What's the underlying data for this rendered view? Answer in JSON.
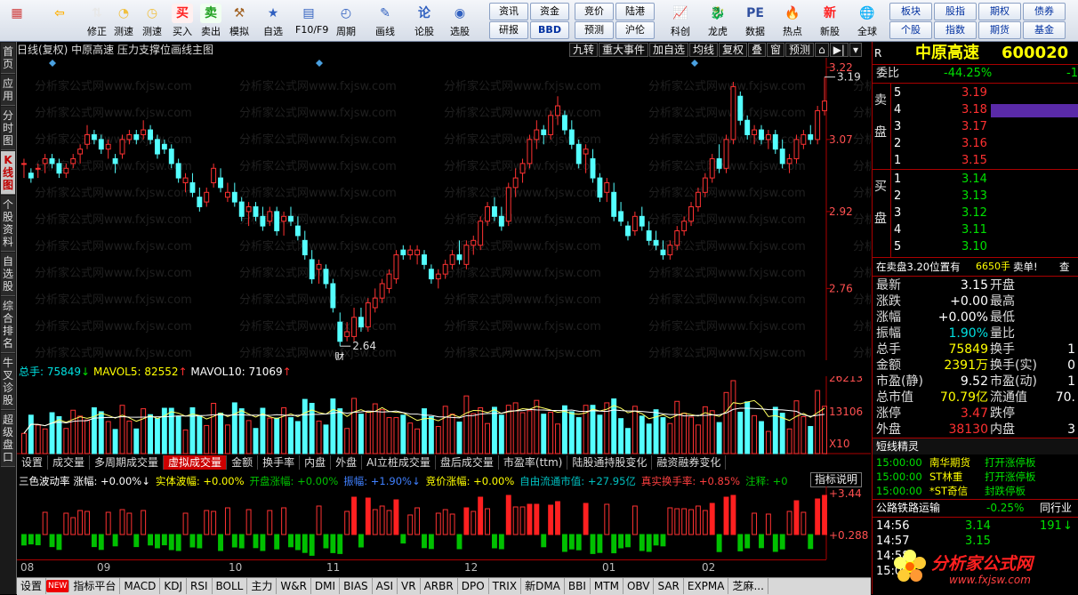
{
  "toolbar": {
    "buttons": [
      {
        "label": "",
        "icon": "windows-icon"
      },
      {
        "label": "",
        "icon": "back-arrow-icon"
      },
      {
        "label": "修正",
        "icon": "up-down-arrow-icon"
      },
      {
        "label": "测速",
        "icon": "speed-test-icon"
      },
      {
        "label": "测速",
        "icon": "clock-icon"
      },
      {
        "label": "买入",
        "icon": "buy-icon"
      },
      {
        "label": "卖出",
        "icon": "sell-icon"
      },
      {
        "label": "模拟",
        "icon": "gavel-icon"
      },
      {
        "label": "自选",
        "icon": "favorites-icon"
      },
      {
        "label": "F10/F9",
        "icon": "f10-icon"
      },
      {
        "label": "周期",
        "icon": "period-icon"
      },
      {
        "label": "画线",
        "icon": "draw-line-icon"
      },
      {
        "label": "论股",
        "icon": "discuss-icon"
      },
      {
        "label": "选股",
        "icon": "stock-picker-icon"
      }
    ],
    "small_grid_1": [
      "资讯",
      "资金",
      "竞价",
      "陆港",
      "研报",
      "BBD",
      "预测",
      "沪伦"
    ],
    "big_buttons": [
      {
        "label": "科创",
        "icon": "chart-icon"
      },
      {
        "label": "龙虎",
        "icon": "dragon-tiger-icon"
      },
      {
        "label": "数据",
        "icon": "pe-data-icon"
      },
      {
        "label": "热点",
        "icon": "hotspot-icon"
      },
      {
        "label": "新股",
        "icon": "new-stock-icon"
      },
      {
        "label": "全球",
        "icon": "globe-icon"
      }
    ],
    "small_grid_2": [
      "板块",
      "股指",
      "期权",
      "债券",
      "个股",
      "指数",
      "期货",
      "基金"
    ]
  },
  "left_tabs": [
    {
      "label": "首页",
      "active": false
    },
    {
      "label": "应用",
      "active": false
    },
    {
      "label": "分时图",
      "active": false
    },
    {
      "label": "K线图",
      "active": true
    },
    {
      "label": "个股资料",
      "active": false
    },
    {
      "label": "自选股",
      "active": false
    },
    {
      "label": "综合排名",
      "active": false
    },
    {
      "label": "牛叉诊股",
      "active": false
    },
    {
      "label": "超级盘口",
      "active": false
    }
  ],
  "main_chart": {
    "header": "日线(复权)  中原高速  压力支撑位画线主图",
    "tools": [
      "九转",
      "重大事件",
      "加自选",
      "均线",
      "复权",
      "叠",
      "窗",
      "预测",
      "⌂",
      "▶|",
      "▾"
    ],
    "price_axis": [
      "3.22",
      "3.07",
      "2.92",
      "2.76"
    ],
    "high_label": "3.19",
    "low_label": "2.64",
    "event_marker": "财",
    "watermark": "分析家公式网www.fxjsw.com"
  },
  "volume": {
    "header_total_label": "总手: 75849",
    "header_ma5_label": "MAVOL5: 82552",
    "header_ma10_label": "MAVOL10: 71069",
    "axis": [
      "26213",
      "13106",
      "X10"
    ]
  },
  "volume_tabs": [
    {
      "label": "设置",
      "active": false
    },
    {
      "label": "成交量",
      "active": false
    },
    {
      "label": "多周期成交量",
      "active": false
    },
    {
      "label": "虚拟成交量",
      "active": true
    },
    {
      "label": "金额",
      "active": false
    },
    {
      "label": "换手率",
      "active": false
    },
    {
      "label": "内盘",
      "active": false
    },
    {
      "label": "外盘",
      "active": false
    },
    {
      "label": "AI立桩成交量",
      "active": false
    },
    {
      "label": "盘后成交量",
      "active": false
    },
    {
      "label": "市盈率(ttm)",
      "active": false
    },
    {
      "label": "陆股通持股变化",
      "active": false
    },
    {
      "label": "融资融券变化",
      "active": false
    }
  ],
  "indicator": {
    "name": "三色波动率",
    "items": [
      {
        "label": "涨幅: +0.00%↓",
        "color": "#ffffff"
      },
      {
        "label": "实体波幅: +0.00%",
        "color": "#ffff00"
      },
      {
        "label": "开盘涨幅: +0.00%",
        "color": "#00c000"
      },
      {
        "label": "振幅: +1.90%↓",
        "color": "#4080ff"
      },
      {
        "label": "竞价涨幅: +0.00%",
        "color": "#ffff00"
      },
      {
        "label": "自由流通市值: +27.95亿",
        "color": "#00c0c0"
      },
      {
        "label": "真实换手率: +0.85%",
        "color": "#ff4040"
      },
      {
        "label": "注释: +0",
        "color": "#00c000"
      }
    ],
    "button": "指标说明",
    "axis": [
      "+3.44",
      "+0.288"
    ]
  },
  "x_axis": [
    "08",
    "09",
    "10",
    "11",
    "12",
    "01",
    "02"
  ],
  "bottom_tabs": [
    "设置",
    "NEW",
    "指标平台",
    "MACD",
    "KDJ",
    "RSI",
    "BOLL",
    "主力",
    "W&R",
    "DMI",
    "BIAS",
    "ASI",
    "VR",
    "ARBR",
    "DPO",
    "TRIX",
    "新DMA",
    "BBI",
    "MTM",
    "OBV",
    "SAR",
    "EXPMA",
    "芝麻..."
  ],
  "quote": {
    "market": "R",
    "name": "中原高速",
    "code": "600020",
    "weibi_label": "委比",
    "weibi": "-44.25%",
    "weibi_extra": "-1",
    "sell_side": "卖盘",
    "buy_side": "买盘",
    "asks": [
      {
        "level": "5",
        "price": "3.19",
        "vol": ""
      },
      {
        "level": "4",
        "price": "3.18",
        "vol": ""
      },
      {
        "level": "3",
        "price": "3.17",
        "vol": ""
      },
      {
        "level": "2",
        "price": "3.16",
        "vol": ""
      },
      {
        "level": "1",
        "price": "3.15",
        "vol": ""
      }
    ],
    "bids": [
      {
        "level": "1",
        "price": "3.14",
        "vol": ""
      },
      {
        "level": "2",
        "price": "3.13",
        "vol": ""
      },
      {
        "level": "3",
        "price": "3.12",
        "vol": ""
      },
      {
        "level": "4",
        "price": "3.11",
        "vol": ""
      },
      {
        "level": "5",
        "price": "3.10",
        "vol": ""
      }
    ],
    "alert_text": "在卖盘3.20位置有",
    "alert_vol": "6650手",
    "alert_tail": "卖单!",
    "alert_link": "查",
    "stats_left": [
      {
        "label": "最新",
        "value": "3.15",
        "cls": "white"
      },
      {
        "label": "涨跌",
        "value": "+0.00",
        "cls": "white"
      },
      {
        "label": "涨幅",
        "value": "+0.00%",
        "cls": "white"
      },
      {
        "label": "振幅",
        "value": "1.90%",
        "cls": "cyan"
      },
      {
        "label": "总手",
        "value": "75849",
        "cls": "yellow"
      },
      {
        "label": "金额",
        "value": "2391万",
        "cls": "yellow"
      },
      {
        "label": "市盈(静)",
        "value": "9.52",
        "cls": "white"
      },
      {
        "label": "总市值",
        "value": "70.79亿",
        "cls": "yellow"
      },
      {
        "label": "涨停",
        "value": "3.47",
        "cls": "red"
      },
      {
        "label": "外盘",
        "value": "38130",
        "cls": "red"
      }
    ],
    "stats_right": [
      {
        "label": "开盘",
        "value": ""
      },
      {
        "label": "最高",
        "value": ""
      },
      {
        "label": "最低",
        "value": ""
      },
      {
        "label": "量比",
        "value": ""
      },
      {
        "label": "换手",
        "value": "1"
      },
      {
        "label": "换手(实)",
        "value": "0"
      },
      {
        "label": "市盈(动)",
        "value": "1"
      },
      {
        "label": "流通值",
        "value": "70."
      },
      {
        "label": "跌停",
        "value": ""
      },
      {
        "label": "内盘",
        "value": "3"
      }
    ],
    "spirit_title": "短线精灵",
    "spirit": [
      {
        "time": "15:00:00",
        "name": "南华期货",
        "event": "打开涨停板"
      },
      {
        "time": "15:00:00",
        "name": "ST林重",
        "event": "打开涨停板"
      },
      {
        "time": "15:00:00",
        "name": "*ST奇信",
        "event": "封跌停板"
      }
    ],
    "sector_name": "公路铁路运输",
    "sector_change": "-0.25%",
    "sector_link": "同行业",
    "ticks": [
      {
        "time": "14:56",
        "price": "3.14",
        "vol": "191",
        "dir": "↓"
      },
      {
        "time": "14:57",
        "price": "3.15",
        "vol": "",
        "dir": ""
      },
      {
        "time": "14:58",
        "price": "",
        "vol": "",
        "dir": ""
      },
      {
        "time": "15:00",
        "price": "",
        "vol": "",
        "dir": ""
      }
    ],
    "logo_text": "分析家公式网",
    "logo_url": "www.fxjsw.com"
  },
  "chart_data": {
    "type": "candlestick",
    "title": "",
    "price_range": [
      2.62,
      3.24
    ],
    "candles": [
      [
        3.02,
        3.03,
        2.99,
        3.02
      ],
      [
        3.0,
        3.01,
        2.98,
        2.99
      ],
      [
        3.01,
        3.02,
        2.99,
        3.01
      ],
      [
        3.02,
        3.04,
        3.0,
        3.03
      ],
      [
        3.03,
        3.04,
        3.01,
        3.02
      ],
      [
        3.02,
        3.03,
        2.99,
        3.0
      ],
      [
        3.0,
        3.02,
        2.99,
        3.01
      ],
      [
        3.02,
        3.04,
        3.01,
        3.03
      ],
      [
        3.04,
        3.06,
        3.02,
        3.05
      ],
      [
        3.06,
        3.1,
        3.05,
        3.08
      ],
      [
        3.08,
        3.09,
        3.06,
        3.07
      ],
      [
        3.07,
        3.08,
        3.04,
        3.05
      ],
      [
        3.05,
        3.07,
        3.03,
        3.06
      ],
      [
        3.03,
        3.04,
        3.0,
        3.02
      ],
      [
        3.04,
        3.08,
        3.03,
        3.07
      ],
      [
        3.07,
        3.09,
        3.06,
        3.08
      ],
      [
        3.08,
        3.09,
        3.06,
        3.07
      ],
      [
        3.08,
        3.11,
        3.07,
        3.09
      ],
      [
        3.09,
        3.1,
        3.06,
        3.07
      ],
      [
        3.07,
        3.08,
        3.03,
        3.04
      ],
      [
        3.06,
        3.07,
        3.04,
        3.05
      ],
      [
        3.05,
        3.06,
        3.01,
        3.02
      ],
      [
        3.02,
        3.03,
        2.98,
        2.99
      ],
      [
        2.98,
        3.0,
        2.96,
        2.99
      ],
      [
        2.98,
        3.0,
        2.95,
        2.96
      ],
      [
        2.95,
        2.97,
        2.92,
        2.93
      ],
      [
        2.94,
        2.97,
        2.93,
        2.96
      ],
      [
        2.98,
        3.02,
        2.97,
        3.01
      ],
      [
        2.99,
        3.01,
        2.96,
        2.97
      ],
      [
        2.95,
        2.98,
        2.94,
        2.96
      ],
      [
        2.96,
        2.98,
        2.93,
        2.94
      ],
      [
        2.94,
        2.95,
        2.9,
        2.91
      ],
      [
        2.92,
        2.94,
        2.89,
        2.93
      ],
      [
        2.93,
        2.94,
        2.9,
        2.91
      ],
      [
        2.91,
        2.93,
        2.88,
        2.89
      ],
      [
        2.9,
        2.93,
        2.89,
        2.92
      ],
      [
        2.92,
        2.93,
        2.87,
        2.88
      ],
      [
        2.9,
        2.92,
        2.87,
        2.91
      ],
      [
        2.91,
        2.93,
        2.89,
        2.9
      ],
      [
        2.89,
        2.91,
        2.86,
        2.87
      ],
      [
        2.86,
        2.88,
        2.82,
        2.83
      ],
      [
        2.82,
        2.84,
        2.77,
        2.78
      ],
      [
        2.8,
        2.82,
        2.77,
        2.81
      ],
      [
        2.8,
        2.81,
        2.76,
        2.77
      ],
      [
        2.77,
        2.78,
        2.71,
        2.72
      ],
      [
        2.69,
        2.71,
        2.64,
        2.65
      ],
      [
        2.66,
        2.69,
        2.65,
        2.67
      ],
      [
        2.66,
        2.72,
        2.65,
        2.7
      ],
      [
        2.7,
        2.72,
        2.67,
        2.68
      ],
      [
        2.68,
        2.74,
        2.67,
        2.73
      ],
      [
        2.72,
        2.76,
        2.71,
        2.74
      ],
      [
        2.74,
        2.78,
        2.73,
        2.77
      ],
      [
        2.76,
        2.8,
        2.75,
        2.79
      ],
      [
        2.78,
        2.84,
        2.77,
        2.83
      ],
      [
        2.84,
        2.85,
        2.82,
        2.83
      ],
      [
        2.83,
        2.85,
        2.82,
        2.84
      ],
      [
        2.83,
        2.85,
        2.81,
        2.84
      ],
      [
        2.83,
        2.84,
        2.8,
        2.81
      ],
      [
        2.8,
        2.81,
        2.77,
        2.78
      ],
      [
        2.78,
        2.8,
        2.76,
        2.79
      ],
      [
        2.79,
        2.82,
        2.78,
        2.81
      ],
      [
        2.81,
        2.84,
        2.8,
        2.83
      ],
      [
        2.83,
        2.86,
        2.81,
        2.82
      ],
      [
        2.81,
        2.86,
        2.8,
        2.85
      ],
      [
        2.85,
        2.87,
        2.83,
        2.86
      ],
      [
        2.85,
        2.91,
        2.84,
        2.9
      ],
      [
        2.9,
        2.94,
        2.89,
        2.93
      ],
      [
        2.93,
        2.95,
        2.9,
        2.91
      ],
      [
        2.91,
        2.93,
        2.88,
        2.89
      ],
      [
        2.9,
        2.98,
        2.89,
        2.97
      ],
      [
        2.97,
        3.01,
        2.95,
        2.99
      ],
      [
        3.0,
        3.03,
        2.98,
        3.02
      ],
      [
        3.02,
        3.08,
        3.01,
        3.07
      ],
      [
        3.07,
        3.11,
        3.05,
        3.09
      ],
      [
        3.09,
        3.1,
        3.06,
        3.08
      ],
      [
        3.08,
        3.13,
        3.07,
        3.12
      ],
      [
        3.12,
        3.16,
        3.1,
        3.14
      ],
      [
        3.12,
        3.13,
        3.08,
        3.09
      ],
      [
        3.09,
        3.11,
        3.05,
        3.06
      ],
      [
        3.06,
        3.07,
        3.01,
        3.02
      ],
      [
        3.04,
        3.06,
        3.0,
        3.05
      ],
      [
        3.03,
        3.05,
        2.98,
        2.99
      ],
      [
        2.99,
        3.0,
        2.94,
        2.95
      ],
      [
        2.96,
        2.99,
        2.94,
        2.98
      ],
      [
        2.96,
        2.98,
        2.9,
        2.91
      ],
      [
        2.92,
        2.94,
        2.89,
        2.9
      ],
      [
        2.89,
        2.9,
        2.86,
        2.87
      ],
      [
        2.88,
        2.92,
        2.87,
        2.91
      ],
      [
        2.91,
        2.93,
        2.88,
        2.89
      ],
      [
        2.88,
        2.9,
        2.85,
        2.86
      ],
      [
        2.86,
        2.88,
        2.84,
        2.85
      ],
      [
        2.84,
        2.86,
        2.82,
        2.83
      ],
      [
        2.83,
        2.86,
        2.82,
        2.85
      ],
      [
        2.85,
        2.89,
        2.84,
        2.88
      ],
      [
        2.88,
        2.91,
        2.87,
        2.9
      ],
      [
        2.9,
        2.94,
        2.89,
        2.93
      ],
      [
        2.93,
        2.97,
        2.92,
        2.96
      ],
      [
        2.96,
        3.0,
        2.95,
        2.99
      ],
      [
        2.99,
        3.04,
        2.98,
        3.03
      ],
      [
        3.03,
        3.06,
        3.0,
        3.01
      ],
      [
        3.01,
        3.08,
        3.0,
        3.07
      ],
      [
        3.07,
        3.19,
        3.06,
        3.18
      ],
      [
        3.16,
        3.17,
        3.1,
        3.11
      ],
      [
        3.11,
        3.12,
        3.07,
        3.08
      ],
      [
        3.08,
        3.1,
        3.06,
        3.09
      ],
      [
        3.09,
        3.1,
        3.06,
        3.07
      ],
      [
        3.07,
        3.09,
        3.05,
        3.08
      ],
      [
        3.08,
        3.09,
        3.04,
        3.05
      ],
      [
        3.05,
        3.07,
        3.01,
        3.02
      ],
      [
        3.02,
        3.04,
        3.0,
        3.03
      ],
      [
        3.03,
        3.08,
        3.02,
        3.07
      ],
      [
        3.06,
        3.09,
        3.05,
        3.08
      ],
      [
        3.08,
        3.1,
        3.06,
        3.07
      ],
      [
        3.07,
        3.14,
        3.06,
        3.13
      ],
      [
        3.13,
        3.2,
        3.12,
        3.15
      ]
    ],
    "volume_axis_max": 26213
  }
}
